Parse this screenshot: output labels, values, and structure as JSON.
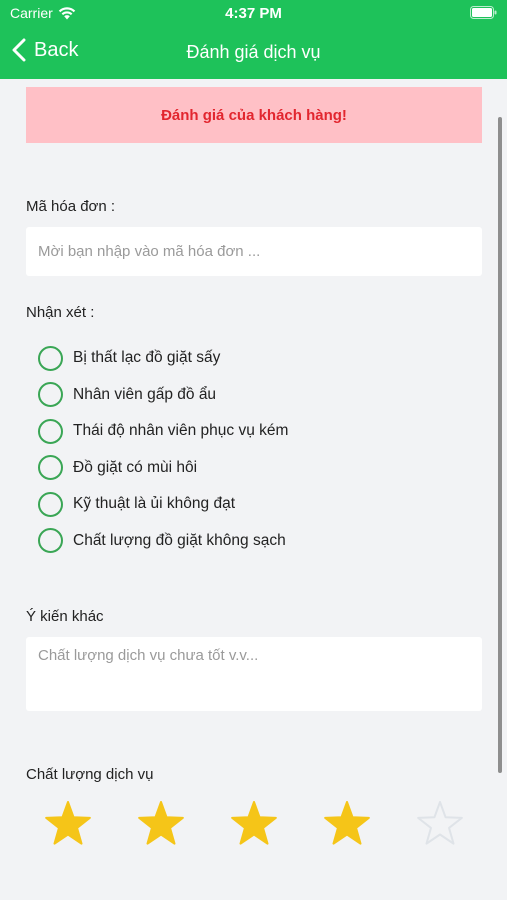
{
  "status": {
    "carrier": "Carrier",
    "time": "4:37 PM"
  },
  "nav": {
    "back_label": "Back",
    "title": "Đánh giá dịch vụ"
  },
  "banner": {
    "text": "Đánh giá của khách hàng!"
  },
  "invoice": {
    "label": "Mã hóa đơn :",
    "placeholder": "Mời bạn nhập vào mã hóa đơn ...",
    "value": ""
  },
  "comments": {
    "label": "Nhận xét :",
    "options": [
      {
        "label": "Bị thất lạc đồ giặt sấy",
        "checked": false
      },
      {
        "label": "Nhân viên gấp đồ ẩu",
        "checked": false
      },
      {
        "label": "Thái độ nhân viên phục vụ kém",
        "checked": false
      },
      {
        "label": "Đồ giặt có mùi hôi",
        "checked": false
      },
      {
        "label": "Kỹ thuật là ủi không đạt",
        "checked": false
      },
      {
        "label": "Chất lượng đồ giặt không sạch",
        "checked": false
      }
    ]
  },
  "other": {
    "label": "Ý kiến khác",
    "placeholder": "Chất lượng dịch vụ chưa tốt v.v...",
    "value": ""
  },
  "quality": {
    "label": "Chất lượng dịch vụ",
    "rating": 4,
    "max": 5
  },
  "colors": {
    "brand": "#1ec25a",
    "banner_bg": "#ffc0c6",
    "banner_text": "#e2262f",
    "radio": "#3aa655",
    "star_filled": "#f5c518",
    "star_empty": "#dfe3e8"
  }
}
